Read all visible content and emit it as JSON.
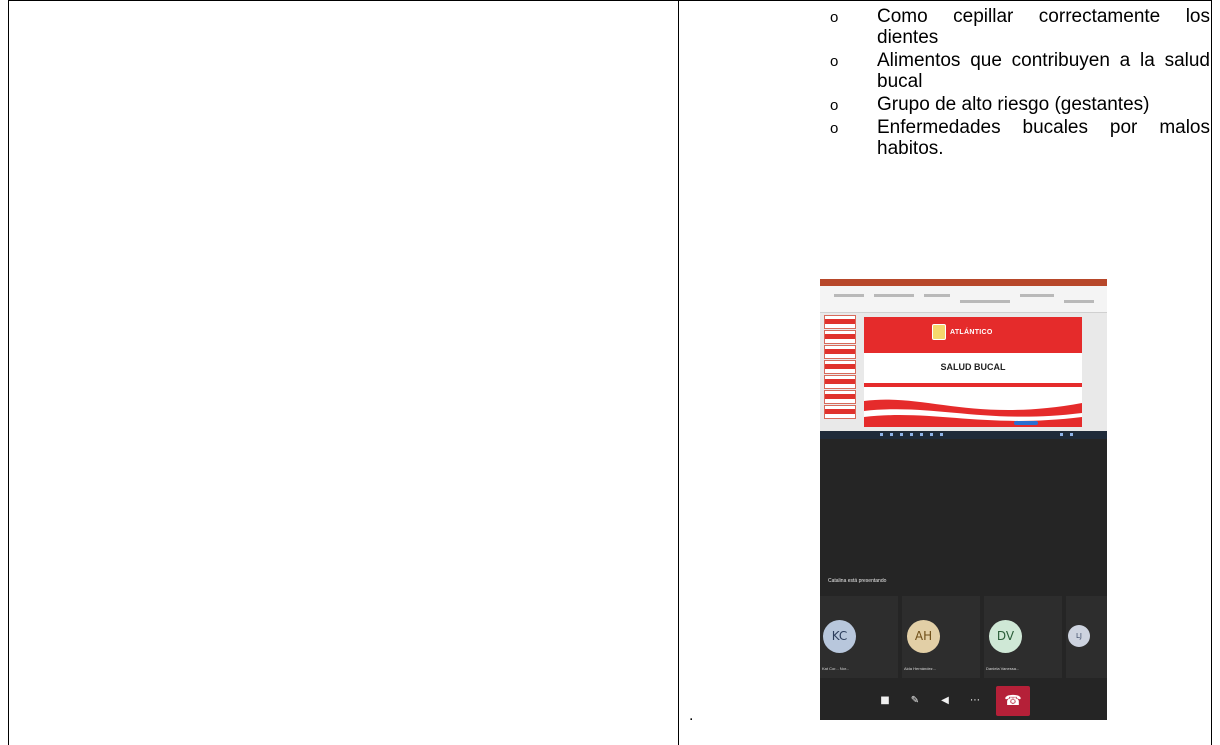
{
  "bullets": [
    {
      "marker": "o",
      "text": "Como cepillar correctamente los dientes"
    },
    {
      "marker": "o",
      "text": "Alimentos que contribuyen a la salud bucal"
    },
    {
      "marker": "o",
      "text": "Grupo de alto riesgo (gestantes)"
    },
    {
      "marker": "o",
      "text": "Enfermedades bucales por malos habitos."
    }
  ],
  "left_note": ".",
  "screenshot": {
    "slide": {
      "logo_text": "ATLÁNTICO",
      "title": "SALUD BUCAL"
    },
    "presenter_label": "Catalina está presentando",
    "participants": [
      {
        "initials": "KC",
        "name": "Kat Cor... Nor..."
      },
      {
        "initials": "AH",
        "name": "Aida Hernández..."
      },
      {
        "initials": "DV",
        "name": "Daniela Vanessa..."
      },
      {
        "initials": "LJ",
        "name": ""
      }
    ],
    "controls": [
      {
        "icon": "video-camera-icon",
        "glyph": "■"
      },
      {
        "icon": "microphone-muted-icon",
        "glyph": "✎"
      },
      {
        "icon": "speaker-icon",
        "glyph": "◀"
      },
      {
        "icon": "more-options-icon",
        "glyph": "⋯"
      },
      {
        "icon": "end-call-icon",
        "glyph": "☎"
      }
    ]
  }
}
